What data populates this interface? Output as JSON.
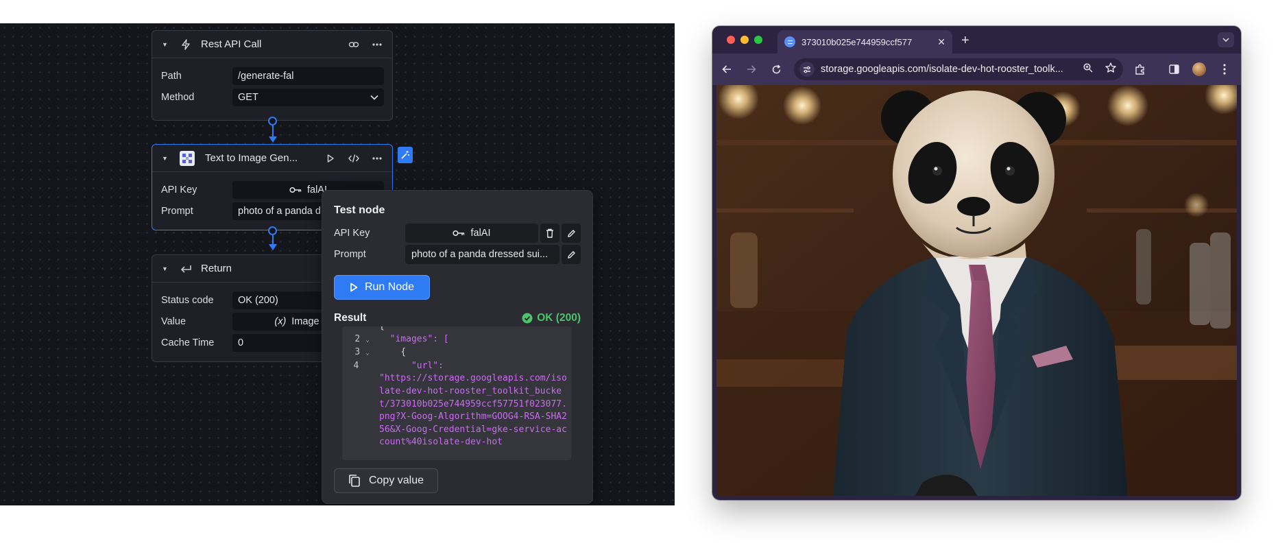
{
  "flow": {
    "rest_node": {
      "title": "Rest API Call",
      "fields": [
        {
          "label": "Path",
          "value": "/generate-fal"
        },
        {
          "label": "Method",
          "value": "GET"
        }
      ]
    },
    "t2i_node": {
      "title": "Text to Image Gen...",
      "fields": [
        {
          "label": "API Key",
          "value": "falAI"
        },
        {
          "label": "Prompt",
          "value": "photo of a panda d"
        }
      ]
    },
    "return_node": {
      "title": "Return",
      "fields": [
        {
          "label": "Status code",
          "value": "OK (200)"
        },
        {
          "label": "Value",
          "value": "Image URL",
          "icon_text": "(x)"
        },
        {
          "label": "Cache Time",
          "value": "0"
        }
      ]
    }
  },
  "test_panel": {
    "title": "Test node",
    "api_key_label": "API Key",
    "api_key_value": "falAI",
    "prompt_label": "Prompt",
    "prompt_value": "photo of a panda dressed sui...",
    "run_label": "Run Node",
    "result_label": "Result",
    "status": "OK (200)",
    "code_lines": [
      {
        "num": "2",
        "fold": "⌄",
        "text": "  \"images\": ["
      },
      {
        "num": "3",
        "fold": "⌄",
        "text": "    {"
      },
      {
        "num": "4",
        "fold": "",
        "text": "      \"url\":"
      },
      {
        "num": "",
        "fold": "",
        "text": "\"https://storage.googleapis.com/isolate-dev-hot-rooster_toolkit_bucket/373010b025e744959ccf57751f023077.png?X-Goog-Algorithm=GOOG4-RSA-SHA256&X-Goog-Credential=gke-service-account%40isolate-dev-hot"
      }
    ],
    "copy_label": "Copy value"
  },
  "browser": {
    "tab_title": "373010b025e744959ccf577",
    "url": "storage.googleapis.com/isolate-dev-hot-rooster_toolk...",
    "image_subject": "panda-in-suit-photo"
  },
  "colors": {
    "accent": "#2f7bf5",
    "success": "#4cc46b",
    "code_string": "#cd6af2",
    "canvas_bg": "#14161b",
    "browser_frame": "#3d3357"
  }
}
